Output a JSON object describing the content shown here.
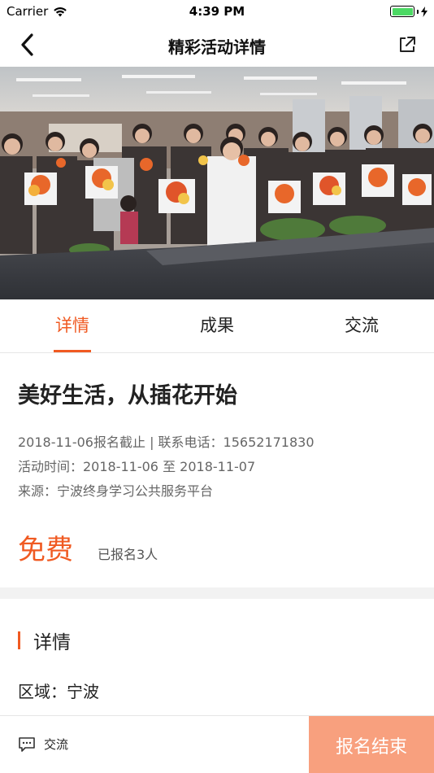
{
  "status_bar": {
    "carrier": "Carrier",
    "time": "4:39 PM",
    "wifi_icon": "wifi-icon",
    "battery_icon": "battery-icon"
  },
  "nav": {
    "title": "精彩活动详情",
    "back_icon": "chevron-left-icon",
    "share_icon": "share-icon"
  },
  "hero": {
    "description_icon": "activity-photo"
  },
  "tabs": [
    {
      "label": "详情",
      "active": true
    },
    {
      "label": "成果",
      "active": false
    },
    {
      "label": "交流",
      "active": false
    }
  ],
  "activity": {
    "title": "美好生活，从插花开始",
    "deadline_line": "2018-11-06报名截止 | 联系电话：15652171830",
    "time_line": "活动时间：2018-11-06 至 2018-11-07",
    "source_line": "来源：宁波终身学习公共服务平台",
    "price": "免费",
    "enrolled": "已报名3人"
  },
  "detail": {
    "title": "详情",
    "region": "区域：宁波"
  },
  "bottom_bar": {
    "chat_label": "交流",
    "chat_icon": "chat-bubble-icon",
    "signup_label": "报名结束"
  },
  "colors": {
    "accent": "#f05a22",
    "signup_button": "#f8a07e",
    "battery": "#4cd964"
  }
}
